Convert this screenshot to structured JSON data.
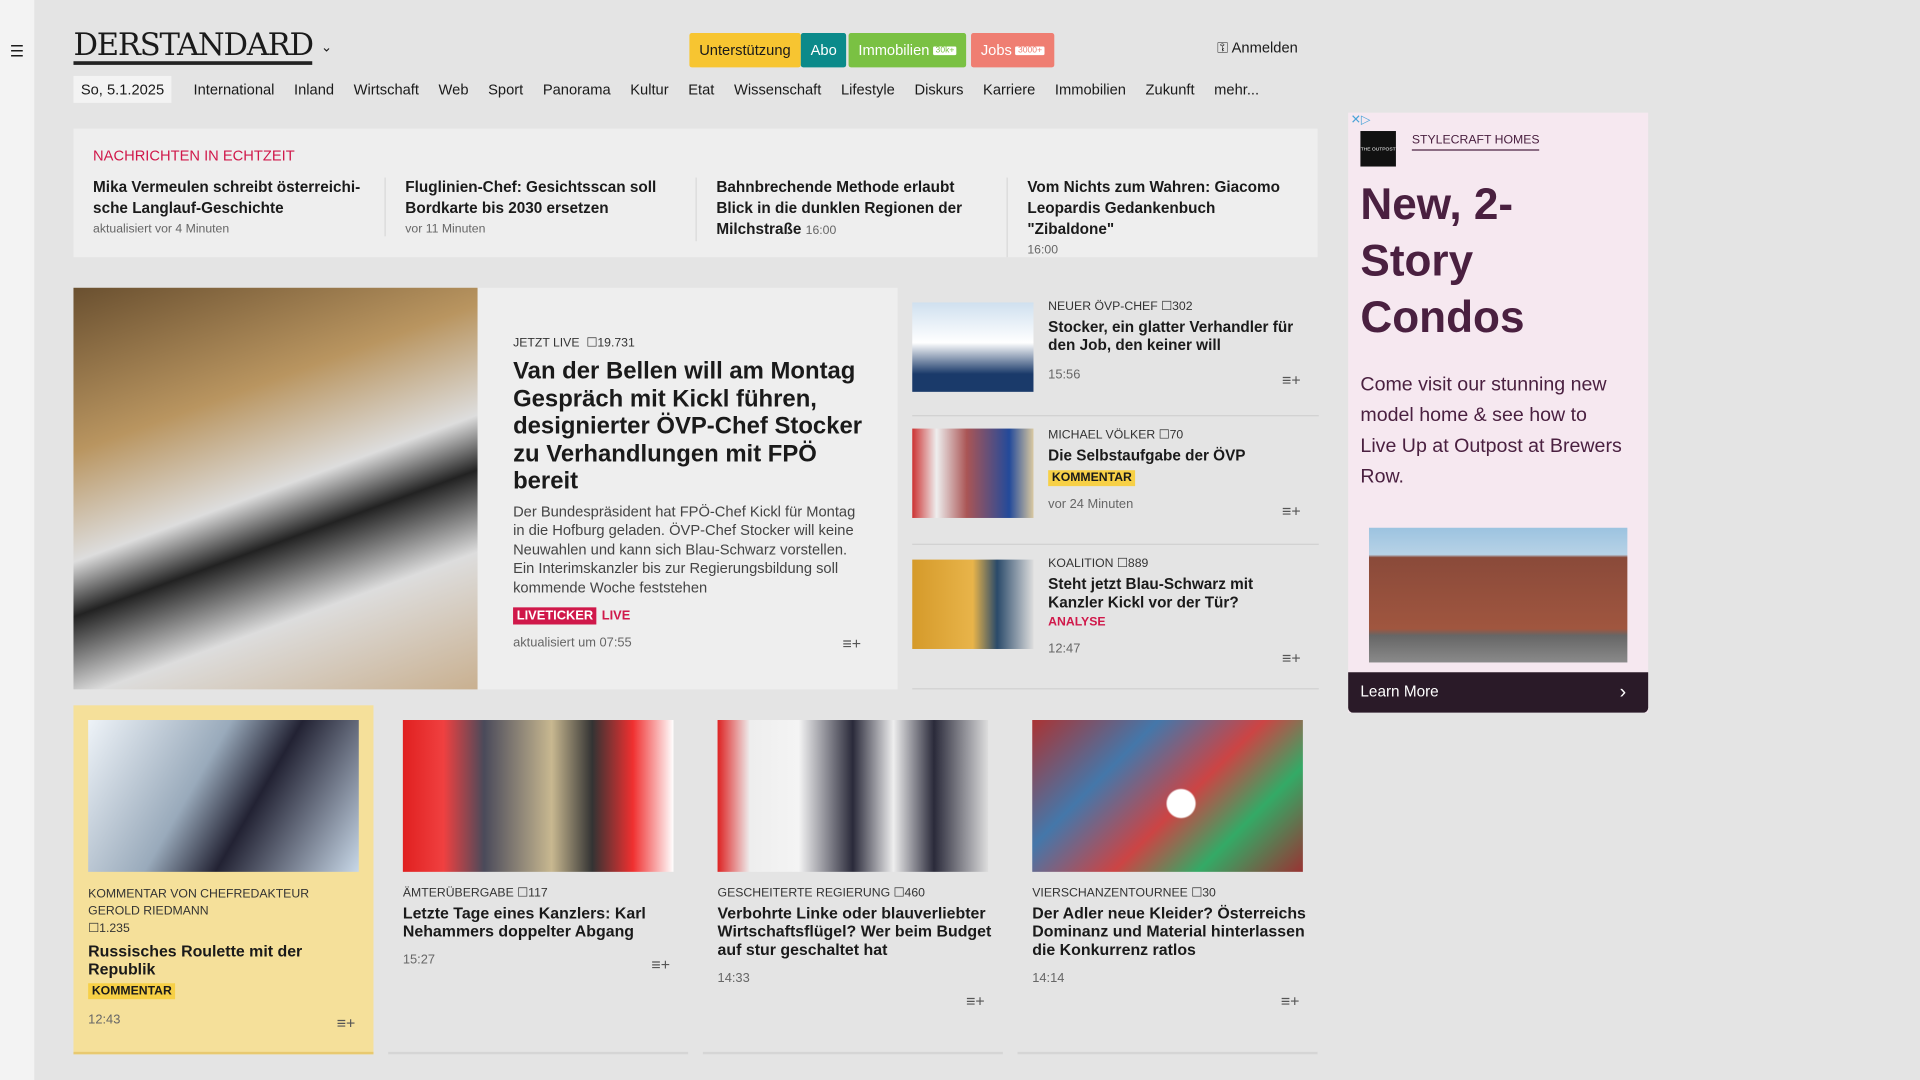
{
  "header": {
    "logo": "DERSTANDARD",
    "pills": [
      {
        "label": "Unterstützung"
      },
      {
        "label": "Abo"
      },
      {
        "label": "Immobilien",
        "badge": "30k+"
      },
      {
        "label": "Jobs",
        "badge": "3000+"
      }
    ],
    "login": "Anmelden"
  },
  "nav": {
    "date": "So, 5.1.2025",
    "items": [
      "International",
      "Inland",
      "Wirtschaft",
      "Web",
      "Sport",
      "Panorama",
      "Kultur",
      "Etat",
      "Wissenschaft",
      "Lifestyle",
      "Diskurs",
      "Karriere",
      "Immobilien",
      "Zukunft",
      "mehr..."
    ]
  },
  "ticker": {
    "label": "NACHRICHTEN IN ECHTZEIT",
    "items": [
      {
        "title": "Mika Vermeulen schreibt österreichi-sche Langlauf-Geschichte",
        "time": "aktualisiert vor 4 Minuten"
      },
      {
        "title": "Fluglinien-Chef: Gesichtsscan soll Bordkarte bis 2030 ersetzen",
        "time": "vor 11 Minuten"
      },
      {
        "title": "Bahnbrechende Methode erlaubt Blick in die dunklen Regionen der Milchstraße",
        "time": "16:00"
      },
      {
        "title": "Vom Nichts zum Wahren: Giacomo Leopardis Gedankenbuch \"Zibaldone\"",
        "time": "16:00"
      }
    ]
  },
  "hero": {
    "kicker": "JETZT LIVE",
    "comments": "19.731",
    "title": "Van der Bellen will am Montag Gespräch mit Kickl führen, designierter ÖVP-Chef Stocker zu Verhandlungen mit FPÖ bereit",
    "teaser": "Der Bundespräsident hat FPÖ-Chef Kickl für Montag in die Hofburg geladen. ÖVP-Chef Stocker will keine Neuwahlen und kann sich Blau-Schwarz vorstellen. Ein Interimskanzler bis zur Regierungsbildung soll kommende Woche feststehen",
    "badge": "LIVETICKER",
    "live": "LIVE",
    "time": "aktualisiert um 07:55"
  },
  "side": [
    {
      "kicker": "NEUER ÖVP-CHEF",
      "comments": "302",
      "title": "Stocker, ein glatter Verhandler für den Job, den keiner will",
      "time": "15:56"
    },
    {
      "kicker": "MICHAEL VÖLKER",
      "comments": "70",
      "title": "Die Selbstaufgabe der ÖVP",
      "tag": "KOMMENTAR",
      "time": "vor 24 Minuten"
    },
    {
      "kicker": "KOALITION",
      "comments": "889",
      "title": "Steht jetzt Blau-Schwarz mit Kanzler Kickl vor der Tür?",
      "tag": "ANALYSE",
      "time": "12:47"
    }
  ],
  "cards": [
    {
      "kicker": "KOMMENTAR VON CHEFREDAKTEUR GEROLD RIEDMANN",
      "comments": "1.235",
      "title": "Russisches Roulette mit der Republik",
      "tag": "KOMMENTAR",
      "time": "12:43"
    },
    {
      "kicker": "ÄMTERÜBERGABE",
      "comments": "117",
      "title": "Letzte Tage eines Kanzlers: Karl Nehammers doppelter Abgang",
      "time": "15:27"
    },
    {
      "kicker": "GESCHEITERTE REGIERUNG",
      "comments": "460",
      "title": "Verbohrte Linke oder blauverliebter Wirtschaftsflügel? Wer beim Budget auf stur geschaltet hat",
      "time": "14:33"
    },
    {
      "kicker": "VIERSCHANZENTOURNEE",
      "comments": "30",
      "title": "Der Adler neue Kleider? Österreichs Dominanz und Material hinterlassen die Konkurrenz ratlos",
      "time": "14:14"
    }
  ],
  "ad": {
    "brand": "STYLECRAFT HOMES",
    "logo_text": "THE OUTPOST",
    "title": "New, 2-Story Condos",
    "body": "Come visit our stunning new model home & see how to Live Up at Outpost at Brewers Row.",
    "cta": "Learn More"
  },
  "colors": {
    "accent": "#d0184a",
    "ad_text": "#4a2040",
    "kommentar": "#f7d046"
  }
}
